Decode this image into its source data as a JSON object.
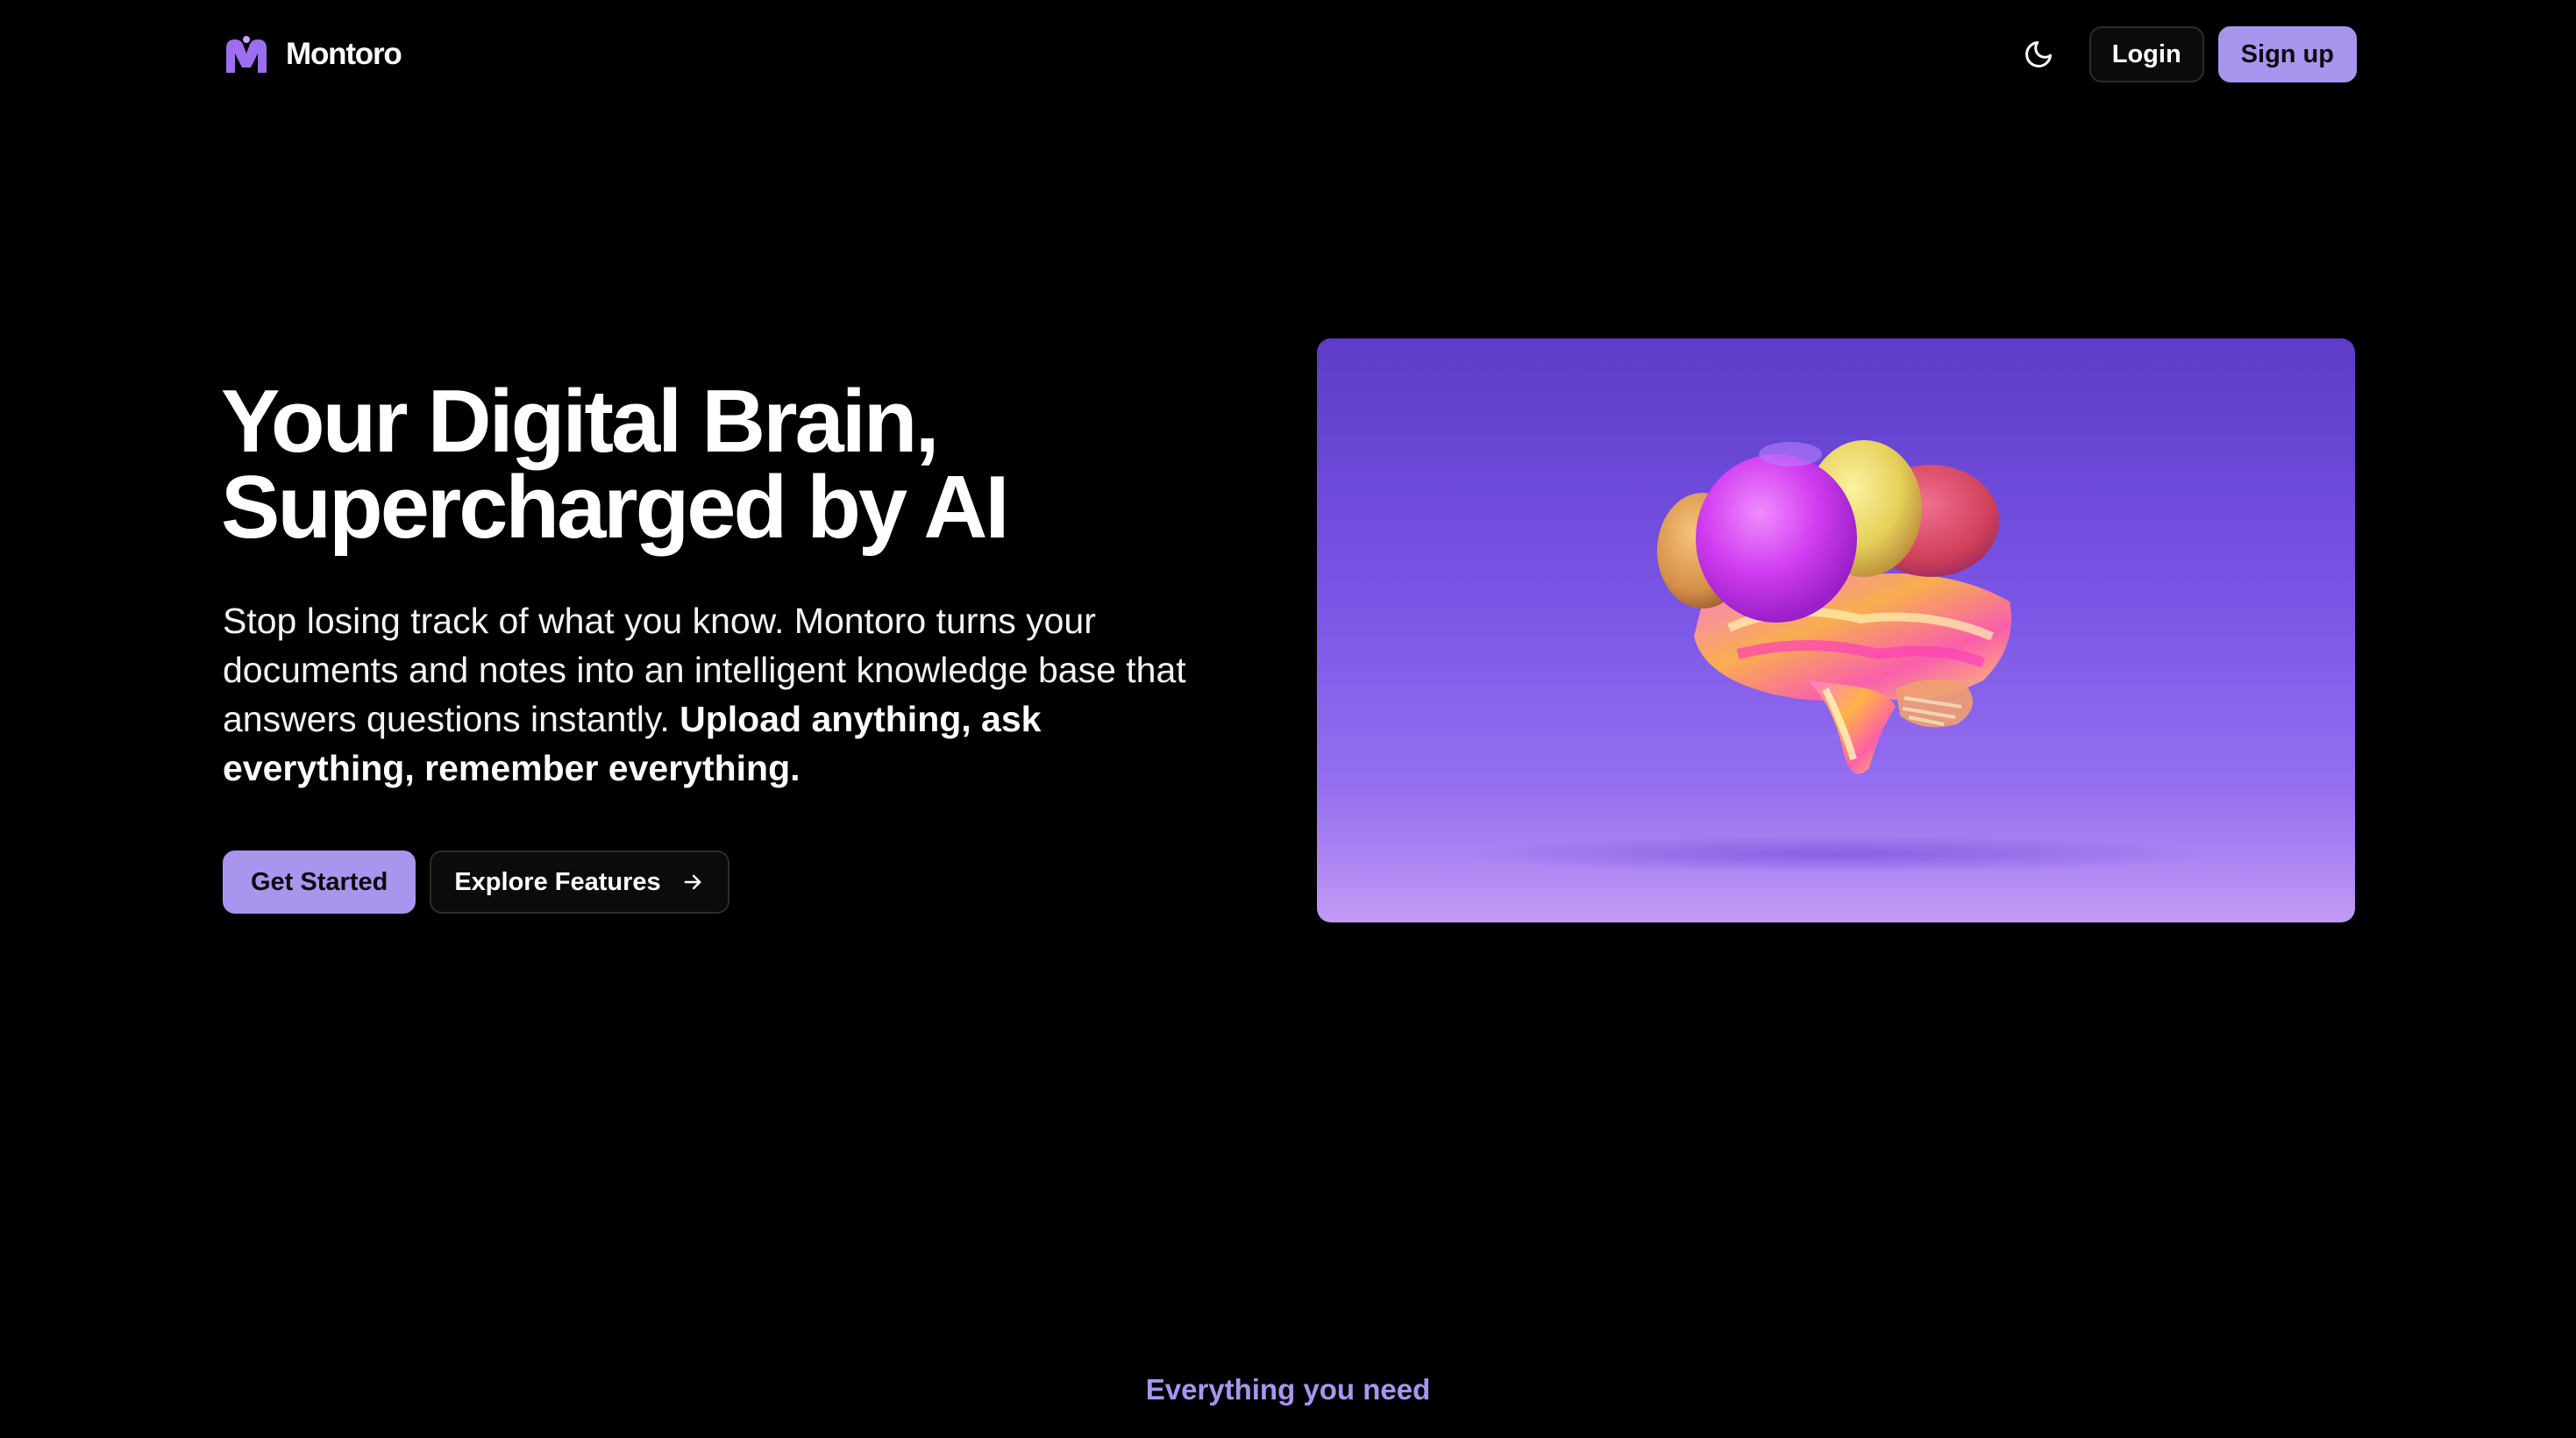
{
  "header": {
    "brand_name": "Montoro",
    "theme_toggle_icon": "moon-icon",
    "login_label": "Login",
    "signup_label": "Sign up"
  },
  "hero": {
    "title_line1": "Your Digital Brain,",
    "title_line2": "Supercharged by AI",
    "description": "Stop losing track of what you know. Montoro turns your documents and notes into an intelligent knowledge base that answers questions instantly.",
    "description_emphasis": "Upload anything, ask everything, remember everything.",
    "primary_cta": "Get Started",
    "secondary_cta": "Explore Features",
    "secondary_cta_icon": "arrow-right-icon",
    "image": "3d-brain-illustration"
  },
  "features": {
    "eyebrow": "Everything you need"
  },
  "colors": {
    "background": "#000000",
    "accent": "#a995ee",
    "card_top": "#5c3cc8",
    "card_bottom": "#c19af5"
  }
}
